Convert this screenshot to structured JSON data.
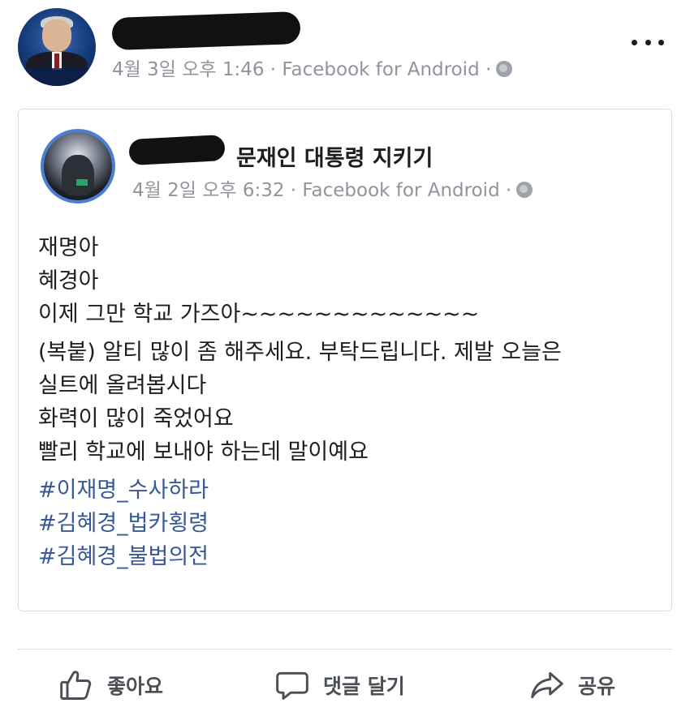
{
  "post": {
    "meta": "4월 3일 오후 1:46 · Facebook for Android ·"
  },
  "shared": {
    "page_name": "문재인 대통령 지키기",
    "meta": "4월 2일 오후 6:32 · Facebook for Android ·",
    "paragraph1": [
      "재명아",
      "혜경아",
      "이제 그만 학교 가즈아~~~~~~~~~~~~~"
    ],
    "paragraph2": [
      "(복붙) 알티 많이 좀 해주세요. 부탁드립니다. 제발 오늘은",
      "실트에 올려봅시다",
      "화력이 많이 죽었어요",
      "빨리 학교에 보내야 하는데 말이예요"
    ],
    "hashtags": [
      "#이재명_수사하라",
      "#김혜경_법카횡령",
      "#김혜경_불법의전"
    ]
  },
  "actions": {
    "like": "좋아요",
    "comment": "댓글 달기",
    "share": "공유"
  },
  "icons": {
    "more": "more-options-icon",
    "privacy": "globe-icon",
    "like": "thumbs-up-icon",
    "comment": "comment-bubble-icon",
    "share": "share-arrow-icon"
  }
}
